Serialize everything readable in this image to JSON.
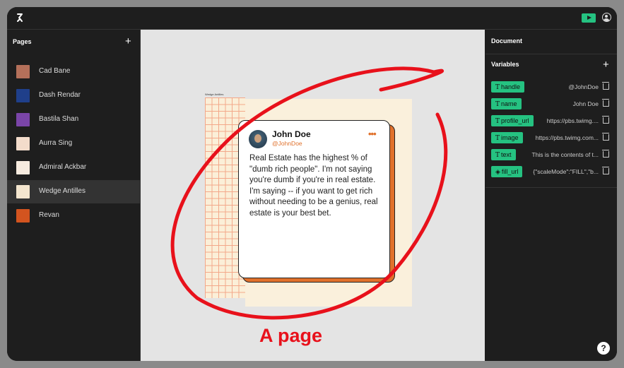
{
  "left_panel": {
    "title": "Pages",
    "pages": [
      {
        "label": "Cad Bane",
        "thumb_color": "#b4705a"
      },
      {
        "label": "Dash Rendar",
        "thumb_color": "#1f3f8a"
      },
      {
        "label": "Bastila Shan",
        "thumb_color": "#7a45a8"
      },
      {
        "label": "Aurra Sing",
        "thumb_color": "#f3dccb"
      },
      {
        "label": "Admiral Ackbar",
        "thumb_color": "#f6ebdf"
      },
      {
        "label": "Wedge Antilles",
        "thumb_color": "#f4e6cf"
      },
      {
        "label": "Revan",
        "thumb_color": "#d3541f"
      }
    ],
    "active_page": "Wedge Antilles"
  },
  "canvas": {
    "frame_label": "Wedge Antilles",
    "card": {
      "name": "John Doe",
      "handle": "@JohnDoe",
      "dots": "•••",
      "text": "Real Estate has the highest % of \"dumb rich people\". I'm not saying you're dumb if you're in real estate. I'm saying -- if you want to get rich without needing to be a genius, real estate is your best bet."
    },
    "annotation": "A page"
  },
  "right_panel": {
    "title": "Document",
    "variables_title": "Variables",
    "variables": [
      {
        "name": "handle",
        "value": "@JohnDoe",
        "icon": "T"
      },
      {
        "name": "name",
        "value": "John Doe",
        "icon": "T"
      },
      {
        "name": "profile_url",
        "value": "https://pbs.twimg....",
        "icon": "T"
      },
      {
        "name": "image",
        "value": "https://pbs.twimg.com...",
        "icon": "T"
      },
      {
        "name": "text",
        "value": "This is the contents of t...",
        "icon": "T"
      },
      {
        "name": "fill_url",
        "value": "{\"scaleMode\":\"FILL\",\"b...",
        "icon": "fill-icon"
      }
    ]
  },
  "help": "?",
  "colors": {
    "accent": "#25c281",
    "annotation": "#e8111b",
    "card_accent": "#e0712c"
  }
}
